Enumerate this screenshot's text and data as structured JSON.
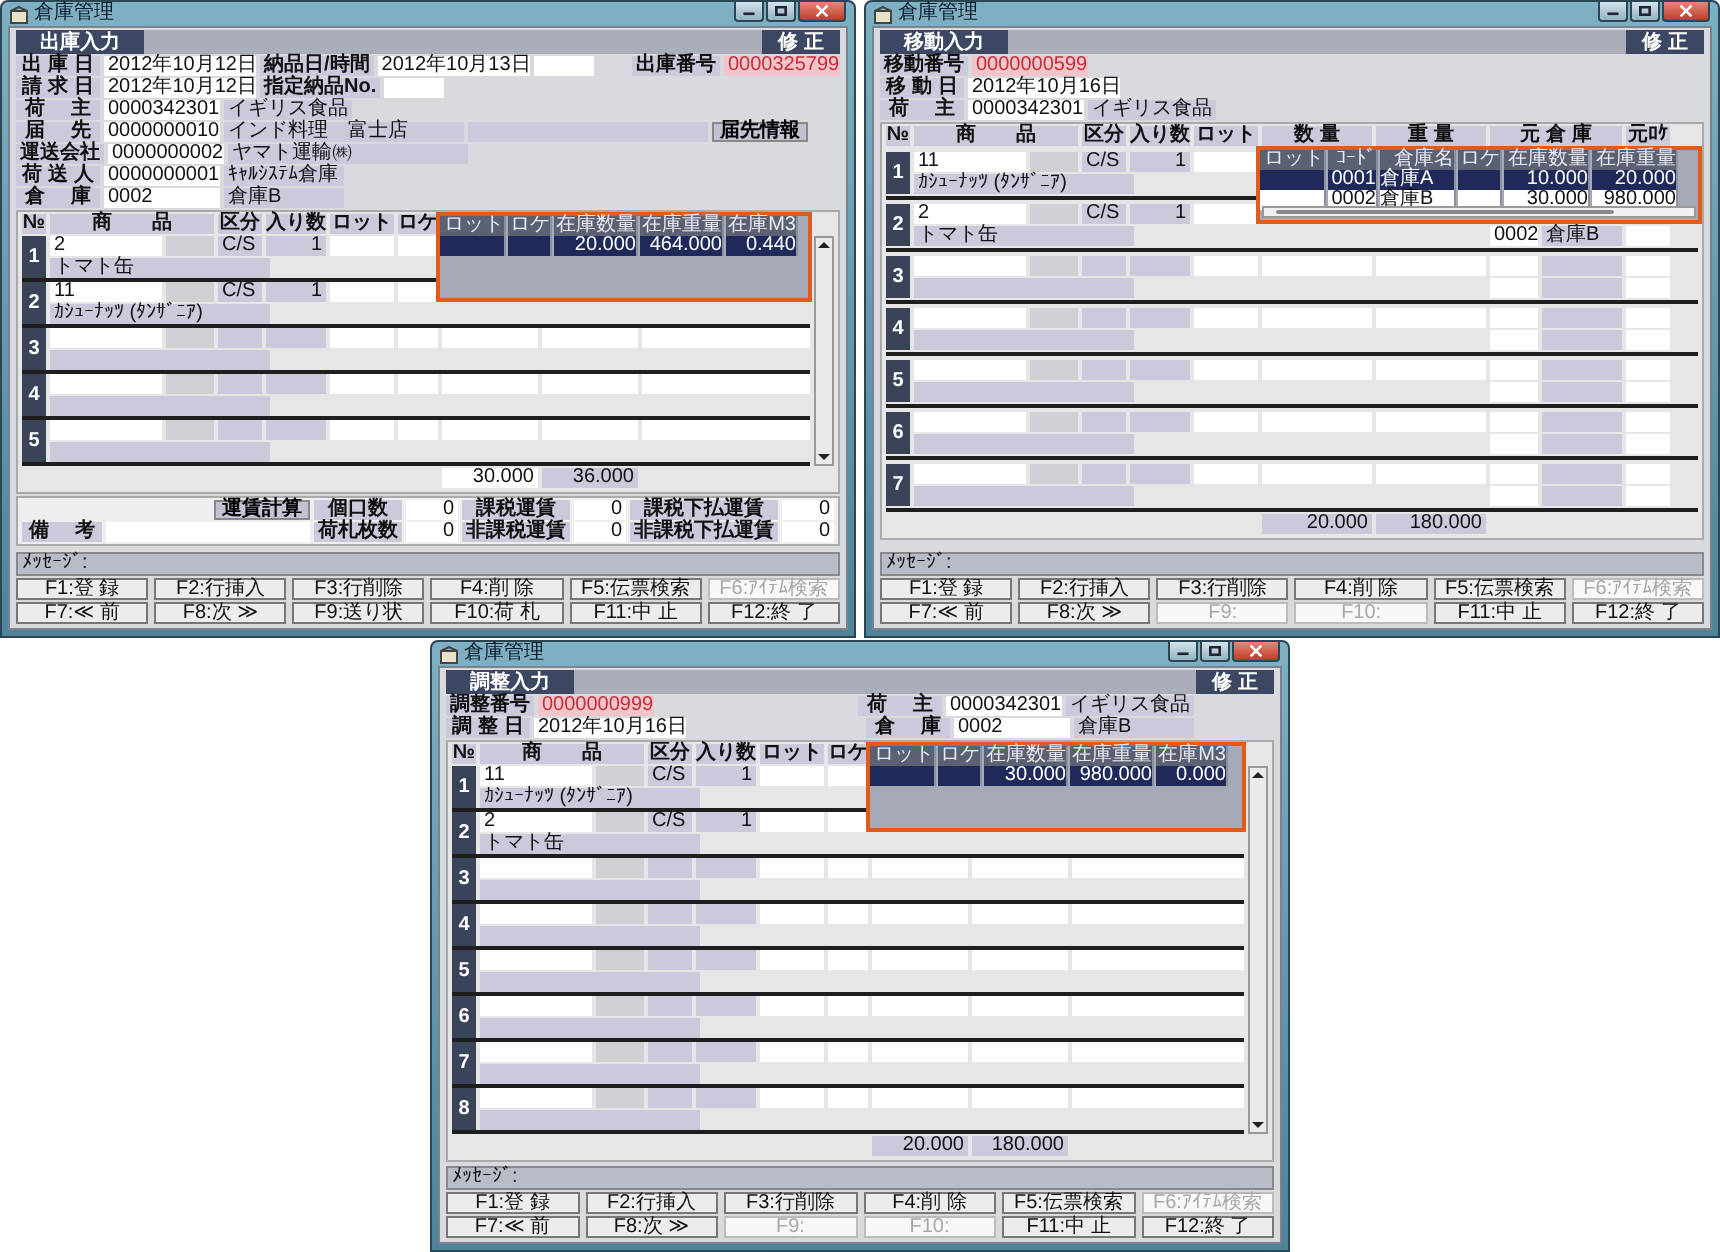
{
  "windows": [
    {
      "title": "倉庫管理",
      "screen": "出庫入力",
      "mode": "修 正",
      "header": [
        {
          "left": [
            {
              "kind": "label",
              "text": "出 庫 日"
            },
            {
              "kind": "date",
              "text": "2012年10月12日"
            },
            {
              "kind": "label",
              "text": "納品日/時間"
            },
            {
              "kind": "date",
              "text": "2012年10月13日"
            },
            {
              "kind": "blank"
            }
          ],
          "right": [
            {
              "kind": "label",
              "text": "出庫番号"
            },
            {
              "kind": "id",
              "text": "0000325799"
            }
          ]
        },
        {
          "left": [
            {
              "kind": "label",
              "text": "請 求 日"
            },
            {
              "kind": "date",
              "text": "2012年10月12日"
            },
            {
              "kind": "label",
              "text": "指定納品No."
            },
            {
              "kind": "blank"
            }
          ]
        },
        {
          "left": [
            {
              "kind": "label",
              "text": "荷　 主"
            },
            {
              "kind": "code",
              "text": "0000342301"
            },
            {
              "kind": "name",
              "text": "イギリス食品"
            }
          ]
        },
        {
          "left": [
            {
              "kind": "label",
              "text": "届　 先"
            },
            {
              "kind": "code",
              "text": "0000000010"
            },
            {
              "kind": "name_wide",
              "text": "インド料理　富士店"
            },
            {
              "kind": "panel"
            },
            {
              "kind": "button",
              "text": "届先情報"
            }
          ]
        },
        {
          "left": [
            {
              "kind": "label",
              "text": "運送会社"
            },
            {
              "kind": "code",
              "text": "0000000002"
            },
            {
              "kind": "name_wide",
              "text": "ヤマト運輸㈱"
            }
          ]
        },
        {
          "left": [
            {
              "kind": "label",
              "text": "荷 送 人"
            },
            {
              "kind": "code",
              "text": "0000000001"
            },
            {
              "kind": "name",
              "text": "ｷｬﾙｼｽﾃﾑ倉庫"
            }
          ]
        },
        {
          "left": [
            {
              "kind": "label",
              "text": "倉　 庫"
            },
            {
              "kind": "code",
              "text": "0002"
            },
            {
              "kind": "name",
              "text": "倉庫B"
            }
          ]
        }
      ],
      "grid": {
        "kind": "lot",
        "columns": [
          "№",
          "商　　品",
          "区分",
          "入り数",
          "ロット",
          "ロケ"
        ],
        "rows": [
          {
            "no": "1",
            "code": "2",
            "name": "トマト缶",
            "unit": "C/S",
            "qty": "1"
          },
          {
            "no": "2",
            "code": "11",
            "name": "ｶｼｭｰﾅｯﾂ (ﾀﾝｻﾞﾆｱ)",
            "unit": "C/S",
            "qty": "1"
          },
          {
            "no": "3"
          },
          {
            "no": "4"
          },
          {
            "no": "5"
          }
        ],
        "totals": [
          {
            "kind": "field",
            "text": "30.000"
          },
          {
            "kind": "readonly",
            "text": "36.000"
          }
        ],
        "popup": {
          "horizontal_scroll": false,
          "columns": [
            "ロット",
            "ロケ",
            "在庫数量",
            "在庫重量",
            "在庫M3"
          ],
          "rows": [
            {
              "selected": true,
              "cells": [
                "",
                "",
                "20.000",
                "464.000",
                "0.440"
              ]
            }
          ]
        }
      },
      "footer": {
        "button": "運賃計算",
        "remarks_label": "備　 考",
        "counters": [
          {
            "label": "個口数",
            "value": "0"
          },
          {
            "label": "課税運賃",
            "value": "0"
          },
          {
            "label": "課税下払運賃",
            "value": "0"
          },
          {
            "label": "荷札枚数",
            "value": "0"
          },
          {
            "label": "非課税運賃",
            "value": "0"
          },
          {
            "label": "非課税下払運賃",
            "value": "0"
          }
        ]
      },
      "message_label": "ﾒｯｾｰｼﾞ:",
      "fkeys": [
        {
          "text": "F1:登 録",
          "disabled": false
        },
        {
          "text": "F2:行挿入",
          "disabled": false
        },
        {
          "text": "F3:行削除",
          "disabled": false
        },
        {
          "text": "F4:削 除",
          "disabled": false
        },
        {
          "text": "F5:伝票検索",
          "disabled": false
        },
        {
          "text": "F6:ｱｲﾃﾑ検索",
          "disabled": true
        },
        {
          "text": "F7:≪ 前",
          "disabled": false
        },
        {
          "text": "F8:次 ≫",
          "disabled": false
        },
        {
          "text": "F9:送り状",
          "disabled": false
        },
        {
          "text": "F10:荷 札",
          "disabled": false
        },
        {
          "text": "F11:中 止",
          "disabled": false
        },
        {
          "text": "F12:終 了",
          "disabled": false
        }
      ]
    },
    {
      "title": "倉庫管理",
      "screen": "移動入力",
      "mode": "修 正",
      "header": [
        {
          "left": [
            {
              "kind": "label",
              "text": "移動番号"
            },
            {
              "kind": "id",
              "text": "0000000599"
            }
          ]
        },
        {
          "left": [
            {
              "kind": "label",
              "text": "移 動 日"
            },
            {
              "kind": "date",
              "text": "2012年10月16日"
            }
          ]
        },
        {
          "left": [
            {
              "kind": "label",
              "text": "荷　 主"
            },
            {
              "kind": "code",
              "text": "0000342301"
            },
            {
              "kind": "name",
              "text": "イギリス食品"
            }
          ]
        }
      ],
      "grid": {
        "kind": "transfer",
        "columns": [
          "№",
          "商　　品",
          "区分",
          "入り数",
          "ロット",
          "数 量",
          "重 量",
          "元 倉 庫",
          "元ﾛｹ"
        ],
        "rows": [
          {
            "no": "1",
            "code": "11",
            "name": "ｶｼｭｰﾅｯﾂ (ﾀﾝｻﾞﾆｱ)",
            "unit": "C/S",
            "qty": "1"
          },
          {
            "no": "2",
            "code": "2",
            "name": "トマト缶",
            "unit": "C/S",
            "qty": "1",
            "from_code": "0002",
            "from_name": "倉庫B"
          },
          {
            "no": "3"
          },
          {
            "no": "4"
          },
          {
            "no": "5"
          },
          {
            "no": "6"
          },
          {
            "no": "7"
          }
        ],
        "totals": [
          {
            "kind": "readonly",
            "text": "20.000"
          },
          {
            "kind": "readonly",
            "text": "180.000"
          }
        ],
        "popup": {
          "horizontal_scroll": true,
          "columns": [
            "ロット",
            "ｺｰﾄﾞ",
            "倉庫名",
            "ロケ",
            "在庫数量",
            "在庫重量"
          ],
          "rows": [
            {
              "selected": true,
              "cells": [
                "",
                "0001",
                "倉庫A",
                "",
                "10.000",
                "20.000"
              ]
            },
            {
              "selected": false,
              "cells": [
                "",
                "0002",
                "倉庫B",
                "",
                "30.000",
                "980.000"
              ]
            }
          ]
        }
      },
      "message_label": "ﾒｯｾｰｼﾞ:",
      "fkeys": [
        {
          "text": "F1:登 録",
          "disabled": false
        },
        {
          "text": "F2:行挿入",
          "disabled": false
        },
        {
          "text": "F3:行削除",
          "disabled": false
        },
        {
          "text": "F4:削 除",
          "disabled": false
        },
        {
          "text": "F5:伝票検索",
          "disabled": false
        },
        {
          "text": "F6:ｱｲﾃﾑ検索",
          "disabled": true
        },
        {
          "text": "F7:≪ 前",
          "disabled": false
        },
        {
          "text": "F8:次 ≫",
          "disabled": false
        },
        {
          "text": "F9:",
          "disabled": true
        },
        {
          "text": "F10:",
          "disabled": true
        },
        {
          "text": "F11:中 止",
          "disabled": false
        },
        {
          "text": "F12:終 了",
          "disabled": false
        }
      ]
    },
    {
      "title": "倉庫管理",
      "screen": "調整入力",
      "mode": "修 正",
      "header": [
        {
          "left": [
            {
              "kind": "label",
              "text": "調整番号"
            },
            {
              "kind": "id",
              "text": "0000000999"
            }
          ],
          "right": [
            {
              "kind": "label",
              "text": "荷　 主"
            },
            {
              "kind": "code",
              "text": "0000342301"
            },
            {
              "kind": "name",
              "text": "イギリス食品"
            }
          ]
        },
        {
          "left": [
            {
              "kind": "label",
              "text": "調 整 日"
            },
            {
              "kind": "date",
              "text": "2012年10月16日"
            }
          ],
          "right": [
            {
              "kind": "label",
              "text": "倉　 庫"
            },
            {
              "kind": "code",
              "text": "0002"
            },
            {
              "kind": "name",
              "text": "倉庫B"
            }
          ]
        }
      ],
      "grid": {
        "kind": "lot",
        "columns": [
          "№",
          "商　　品",
          "区分",
          "入り数",
          "ロット",
          "ロケ"
        ],
        "rows": [
          {
            "no": "1",
            "code": "11",
            "name": "ｶｼｭｰﾅｯﾂ (ﾀﾝｻﾞﾆｱ)",
            "unit": "C/S",
            "qty": "1"
          },
          {
            "no": "2",
            "code": "2",
            "name": "トマト缶",
            "unit": "C/S",
            "qty": "1"
          },
          {
            "no": "3"
          },
          {
            "no": "4"
          },
          {
            "no": "5"
          },
          {
            "no": "6"
          },
          {
            "no": "7"
          },
          {
            "no": "8"
          }
        ],
        "totals": [
          {
            "kind": "readonly",
            "text": "20.000"
          },
          {
            "kind": "readonly",
            "text": "180.000"
          }
        ],
        "popup": {
          "horizontal_scroll": false,
          "columns": [
            "ロット",
            "ロケ",
            "在庫数量",
            "在庫重量",
            "在庫M3"
          ],
          "rows": [
            {
              "selected": true,
              "cells": [
                "",
                "",
                "30.000",
                "980.000",
                "0.000"
              ]
            }
          ]
        }
      },
      "message_label": "ﾒｯｾｰｼﾞ:",
      "fkeys": [
        {
          "text": "F1:登 録",
          "disabled": false
        },
        {
          "text": "F2:行挿入",
          "disabled": false
        },
        {
          "text": "F3:行削除",
          "disabled": false
        },
        {
          "text": "F4:削 除",
          "disabled": false
        },
        {
          "text": "F5:伝票検索",
          "disabled": false
        },
        {
          "text": "F6:ｱｲﾃﾑ検索",
          "disabled": true
        },
        {
          "text": "F7:≪ 前",
          "disabled": false
        },
        {
          "text": "F8:次 ≫",
          "disabled": false
        },
        {
          "text": "F9:",
          "disabled": true
        },
        {
          "text": "F10:",
          "disabled": true
        },
        {
          "text": "F11:中 止",
          "disabled": false
        },
        {
          "text": "F12:終 了",
          "disabled": false
        }
      ]
    }
  ]
}
